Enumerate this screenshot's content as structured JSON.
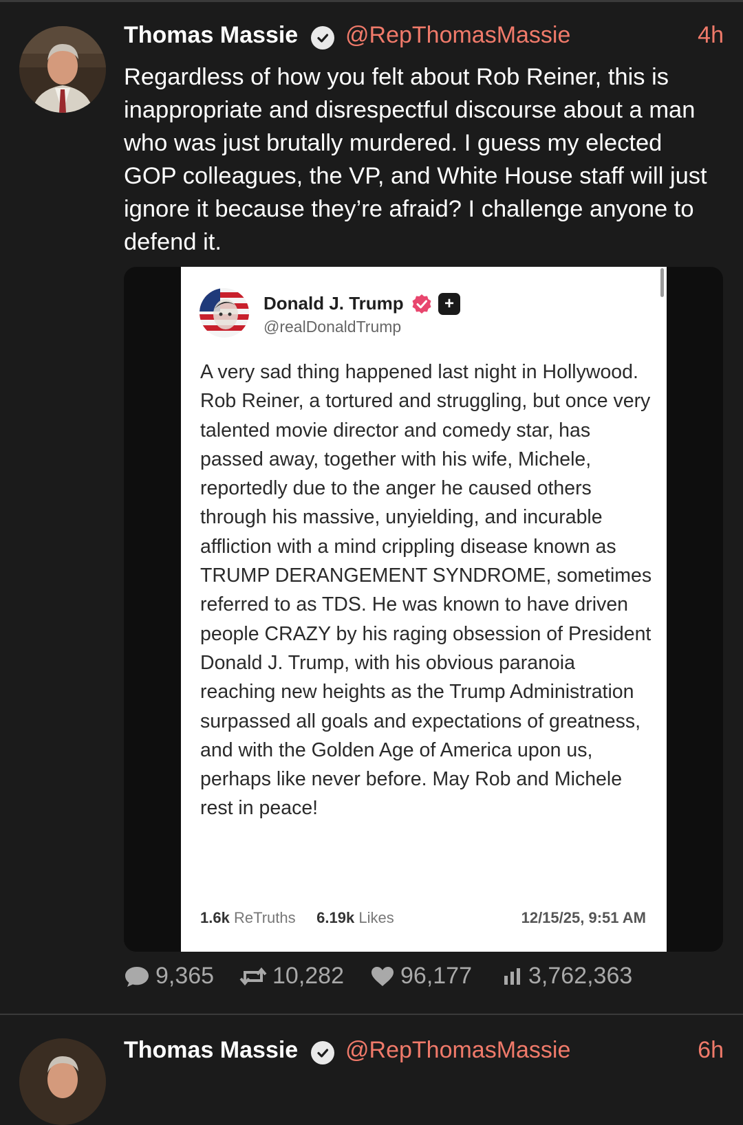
{
  "posts": [
    {
      "author_name": "Thomas Massie",
      "handle": "@RepThomasMassie",
      "time": "4h",
      "text": "Regardless of how you felt about Rob Reiner, this is inappropriate and disrespectful discourse about a man who was just brutally murdered. I guess my elected GOP colleagues, the VP, and White House staff will just ignore it because they’re afraid? I challenge anyone to defend it.",
      "embed": {
        "author_name": "Donald J. Trump",
        "handle": "@realDonaldTrump",
        "text": "A very sad thing happened last night in Hollywood. Rob Reiner, a tortured and struggling, but once very talented movie director and comedy star, has passed away, together with his wife, Michele, reportedly due to the anger he caused others through his massive, unyielding, and incurable affliction with a mind crippling disease known as TRUMP DERANGEMENT SYNDROME, sometimes referred to as TDS. He was known to have driven people CRAZY by his raging obsession of President Donald J. Trump, with his obvious paranoia reaching new heights as the Trump Administration surpassed all goals and expectations of greatness, and with the Golden Age of America upon us, perhaps like never before. May Rob and Michele rest in peace!",
        "retruths_count": "1.6k",
        "retruths_label": "ReTruths",
        "likes_count": "6.19k",
        "likes_label": "Likes",
        "date": "12/15/25, 9:51 AM"
      },
      "stats": {
        "replies": "9,365",
        "reposts": "10,282",
        "likes": "96,177",
        "views": "3,762,363"
      }
    },
    {
      "author_name": "Thomas Massie",
      "handle": "@RepThomasMassie",
      "time": "6h"
    }
  ],
  "colors": {
    "background": "#1b1b1b",
    "accent": "#f07a6a",
    "muted": "#a9a9a9",
    "verified_truth": "#e8466e"
  },
  "icons": [
    "verified-check-icon",
    "reply-icon",
    "repost-icon",
    "like-icon",
    "views-icon",
    "plus-badge-icon"
  ]
}
